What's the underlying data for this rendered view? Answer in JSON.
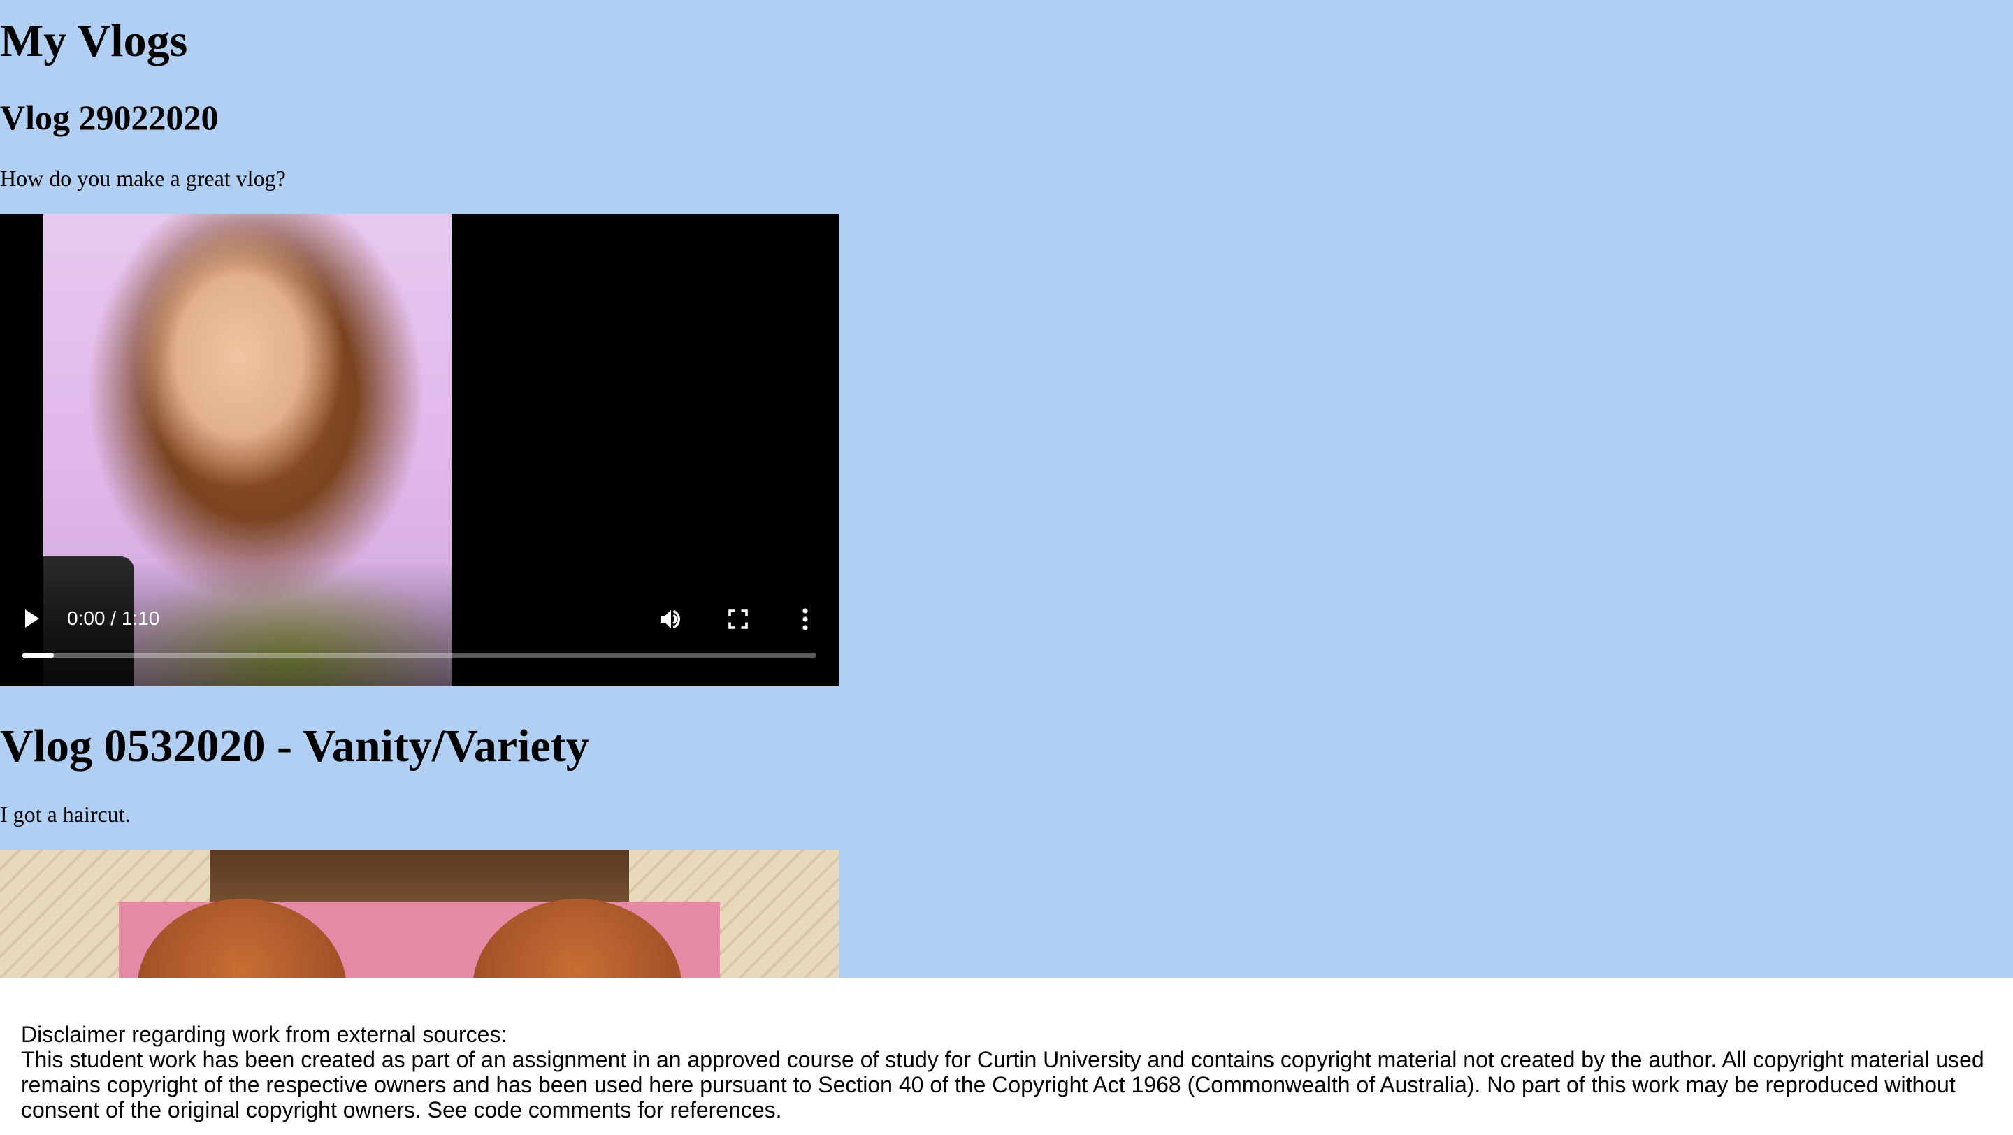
{
  "page": {
    "title": "My Vlogs"
  },
  "vlogs": [
    {
      "title": "Vlog 29022020",
      "description": "How do you make a great vlog?",
      "player": {
        "time": "0:00 / 1:10",
        "progress": 0.04
      }
    },
    {
      "title": "Vlog 0532020 - Vanity/Variety",
      "description": "I got a haircut."
    }
  ],
  "footer": {
    "heading": "Disclaimer regarding work from external sources:",
    "body": "This student work has been created as part of an assignment in an approved course of study for Curtin University and contains copyright material not created by the author. All copyright material used remains copyright of the respective owners and has been used here pursuant to Section 40 of the Copyright Act 1968 (Commonwealth of Australia). No part of this work may be reproduced without consent of the original copyright owners. See code comments for references."
  },
  "icons": {
    "play": "play-icon",
    "volume": "volume-icon",
    "fullscreen": "fullscreen-icon",
    "more": "more-vertical-icon"
  },
  "colors": {
    "page_background": "#b0cff2",
    "footer_background": "#ffffff",
    "player_background": "#000000"
  }
}
